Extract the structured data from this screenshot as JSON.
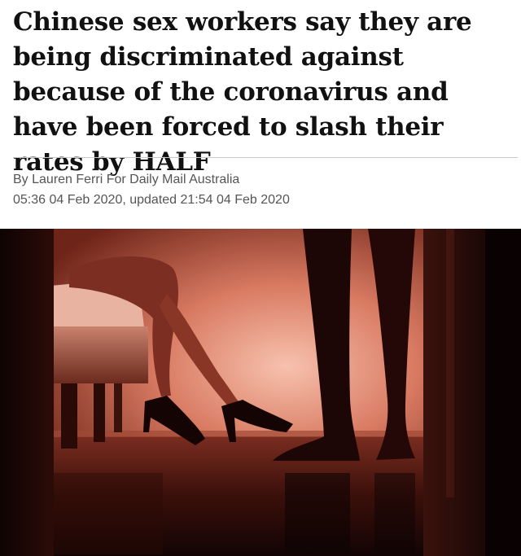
{
  "article": {
    "headline": "Chinese sex workers say they are being discriminated against because of the coronavirus and have been forced to slash their rates by HALF",
    "byline": "By Lauren Ferri For Daily Mail Australia",
    "dateline": "05:36 04 Feb 2020, updated 21:54 04 Feb 2020"
  },
  "photo": {
    "palette": {
      "dark": "#1a0707",
      "glow": "#f2b09a",
      "mid": "#8a3626"
    }
  }
}
